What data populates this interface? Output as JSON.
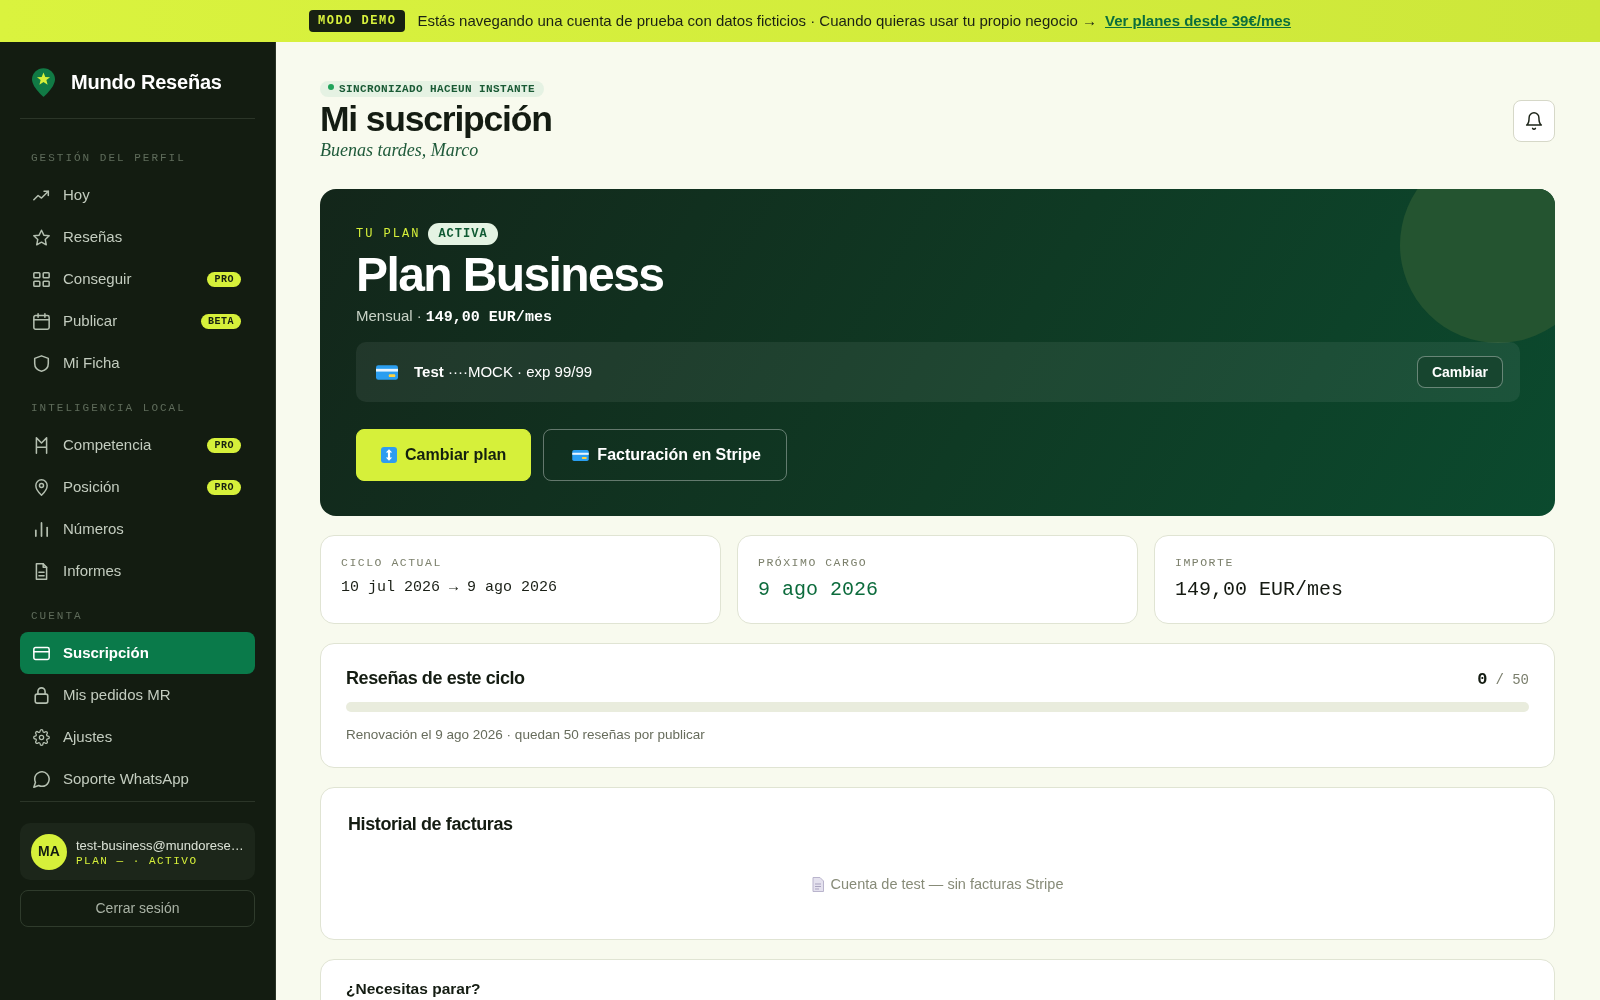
{
  "banner": {
    "badge": "MODO DEMO",
    "message": "Estás navegando una cuenta de prueba con datos ficticios · Cuando quieras usar tu propio negocio →",
    "link": "Ver planes desde 39€/mes"
  },
  "sidebar": {
    "brand": "Mundo Reseñas",
    "sections": [
      {
        "title": "GESTIÓN DEL PERFIL",
        "items": [
          {
            "label": "Hoy",
            "selected": false
          },
          {
            "label": "Reseñas",
            "selected": false
          },
          {
            "label": "Conseguir",
            "badge": "PRO",
            "selected": false
          },
          {
            "label": "Publicar",
            "badge": "BETA",
            "selected": false
          },
          {
            "label": "Mi Ficha",
            "selected": false
          }
        ]
      },
      {
        "title": "INTELIGENCIA LOCAL",
        "items": [
          {
            "label": "Competencia",
            "badge": "PRO",
            "selected": false
          },
          {
            "label": "Posición",
            "badge": "PRO",
            "selected": false
          },
          {
            "label": "Números",
            "selected": false
          },
          {
            "label": "Informes",
            "selected": false
          }
        ]
      },
      {
        "title": "CUENTA",
        "items": [
          {
            "label": "Suscripción",
            "selected": true
          },
          {
            "label": "Mis pedidos MR",
            "selected": false
          },
          {
            "label": "Ajustes",
            "selected": false
          },
          {
            "label": "Soporte WhatsApp",
            "selected": false
          }
        ]
      }
    ],
    "user": {
      "initials": "MA",
      "email": "test-business@mundorese…",
      "plan": "PLAN — · ACTIVO"
    },
    "logout": "Cerrar sesión"
  },
  "header": {
    "sync": "SINCRONIZADO HACEUN INSTANTE",
    "title": "Mi suscripción",
    "greeting": "Buenas tardes, Marco"
  },
  "plan": {
    "eyebrow": "TU PLAN",
    "status": "ACTIVA",
    "name": "Plan Business",
    "billing": "Mensual ·",
    "price": "149,00 EUR/mes",
    "payment": {
      "text": "**Test** ····MOCK · exp 99/99",
      "button": "Cambiar"
    },
    "actions": [
      {
        "label": "Cambiar plan",
        "kind": "primary"
      },
      {
        "label": "Facturación en Stripe",
        "kind": "outline"
      }
    ]
  },
  "stats": [
    {
      "label": "CICLO ACTUAL",
      "value": "10 jul 2026 → 9 ago 2026",
      "kind": "period"
    },
    {
      "label": "PRÓXIMO CARGO",
      "value": "9 ago 2026",
      "kind": "date"
    },
    {
      "label": "IMPORTE",
      "value": "149,00 EUR/mes",
      "kind": "amount"
    }
  ],
  "usage": {
    "title": "Reseñas de este ciclo",
    "used": "0",
    "limit": "/ 50",
    "level": 0,
    "note": "Renovación el 9 ago 2026 · quedan 50 reseñas por publicar"
  },
  "invoices": {
    "title": "Historial de facturas",
    "empty": "Cuenta de test — sin facturas Stripe"
  },
  "pause": {
    "title": "¿Necesitas parar?"
  }
}
